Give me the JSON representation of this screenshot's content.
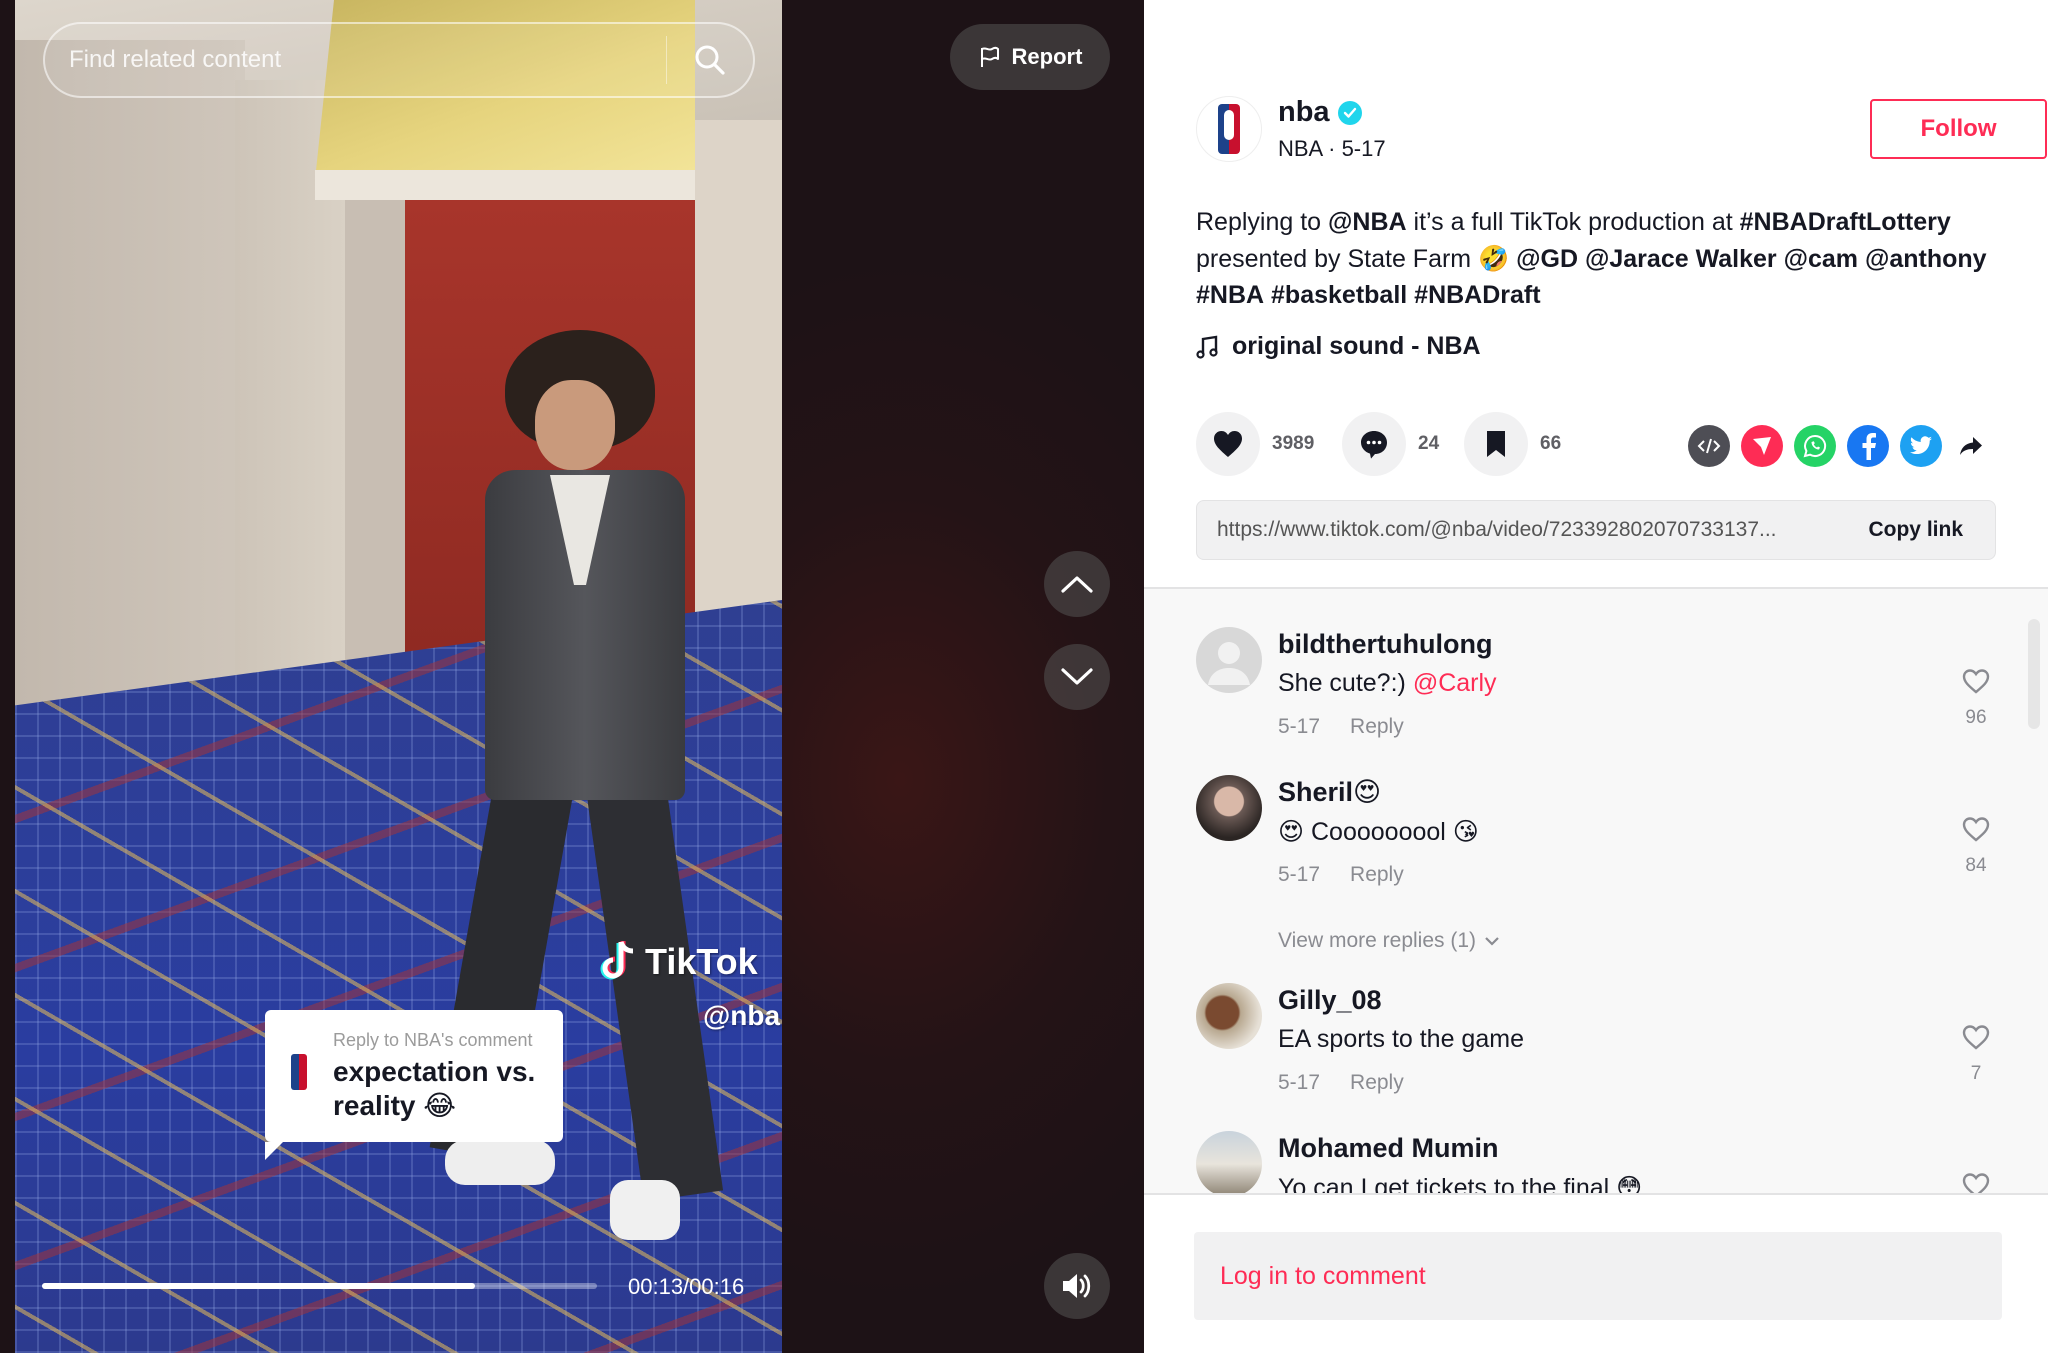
{
  "video": {
    "search": {
      "placeholder": "Find related content"
    },
    "report_label": "Report",
    "watermark": {
      "brand": "TikTok",
      "handle": "@nba"
    },
    "reply_sticker": {
      "label": "Reply to NBA's comment",
      "text": "expectation vs. reality 😂"
    },
    "progress": {
      "current": "00:13",
      "duration": "00:16",
      "time_text": "00:13/00:16",
      "fraction": 0.78
    },
    "icons": {
      "search": "search-icon",
      "report": "flag-icon",
      "prev": "chevron-up-icon",
      "next": "chevron-down-icon",
      "volume": "volume-icon"
    }
  },
  "post": {
    "author": {
      "username": "nba",
      "verified": true,
      "nickname_date": "NBA · 5-17"
    },
    "follow_label": "Follow",
    "description": {
      "parts": [
        {
          "text": "Replying to ",
          "bold": false
        },
        {
          "text": "@NBA",
          "bold": true
        },
        {
          "text": " it’s a full TikTok production at ",
          "bold": false
        },
        {
          "text": "#NBADraftLottery",
          "bold": true
        },
        {
          "text": " presented by State Farm 🤣 ",
          "bold": false
        },
        {
          "text": "@GD",
          "bold": true
        },
        {
          "text": " ",
          "bold": false
        },
        {
          "text": "@Jarace Walker",
          "bold": true
        },
        {
          "text": " ",
          "bold": false
        },
        {
          "text": "@cam",
          "bold": true
        },
        {
          "text": " ",
          "bold": false
        },
        {
          "text": "@anthony",
          "bold": true
        },
        {
          "text": " ",
          "bold": false
        },
        {
          "text": "#NBA",
          "bold": true
        },
        {
          "text": " ",
          "bold": false
        },
        {
          "text": "#basketball",
          "bold": true
        },
        {
          "text": " ",
          "bold": false
        },
        {
          "text": "#NBADraft",
          "bold": true
        }
      ]
    },
    "music": "original sound - NBA",
    "stats": {
      "likes": "3989",
      "comments": "24",
      "saves": "66"
    },
    "share_targets": [
      {
        "name": "embed",
        "color": "#4e4e55"
      },
      {
        "name": "send-to-friends",
        "color": "#fe2c55"
      },
      {
        "name": "whatsapp",
        "color": "#25d366"
      },
      {
        "name": "facebook",
        "color": "#1877f2"
      },
      {
        "name": "twitter",
        "color": "#1da1f2"
      },
      {
        "name": "more-share",
        "color": "#161823"
      }
    ],
    "link": {
      "url": "https://www.tiktok.com/@nba/video/723392802070733137...",
      "copy_label": "Copy link"
    }
  },
  "comments": [
    {
      "username": "bildthertuhulong",
      "text": "She cute?:) ",
      "mention": "@Carly",
      "date": "5-17",
      "reply_label": "Reply",
      "likes": "96"
    },
    {
      "username": "Sheril😍",
      "text": "😍 Cooooooool 😘",
      "mention": "",
      "date": "5-17",
      "reply_label": "Reply",
      "likes": "84",
      "view_more": "View more replies (1)"
    },
    {
      "username": "Gilly_08",
      "text": "EA sports to the game",
      "mention": "",
      "date": "5-17",
      "reply_label": "Reply",
      "likes": "7"
    },
    {
      "username": "Mohamed Mumin",
      "text": "Yo can I get tickets to the final 😳",
      "mention": "",
      "date": "",
      "reply_label": "",
      "likes": ""
    }
  ],
  "login_prompt": "Log in to comment",
  "colors": {
    "brand": "#fe2c55",
    "text": "#161823",
    "muted": "#8a8b91"
  }
}
